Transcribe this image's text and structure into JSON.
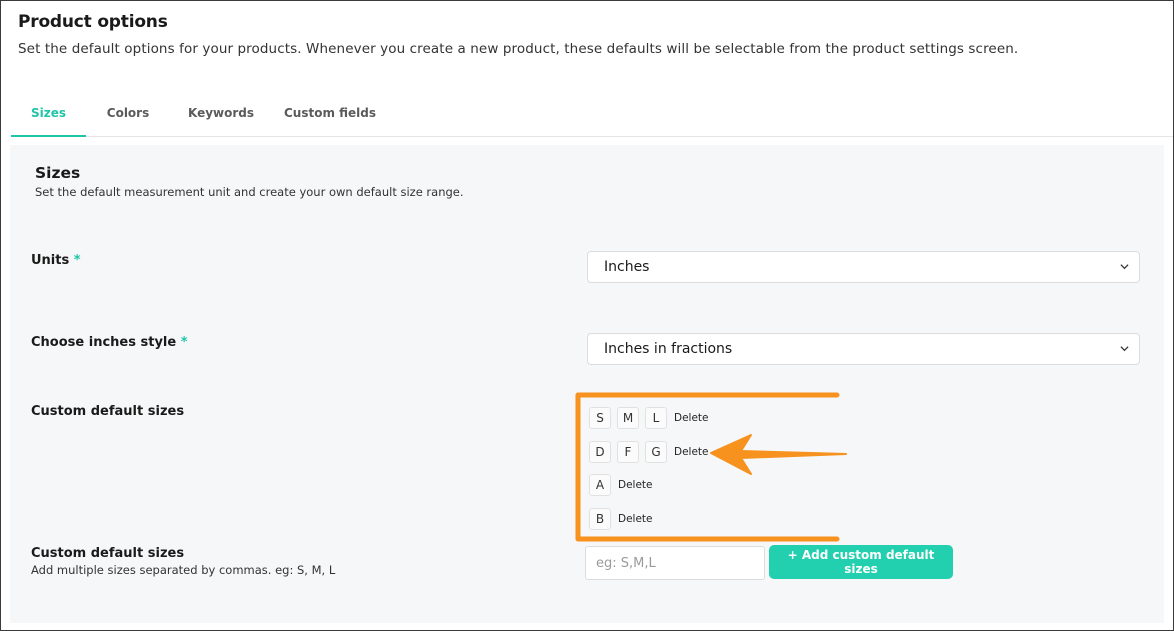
{
  "header": {
    "title": "Product options",
    "subtitle": "Set the default options for your products. Whenever you create a new product, these defaults will be selectable from the product settings screen."
  },
  "tabs": [
    {
      "label": "Sizes",
      "active": true
    },
    {
      "label": "Colors",
      "active": false
    },
    {
      "label": "Keywords",
      "active": false
    },
    {
      "label": "Custom fields",
      "active": false
    }
  ],
  "sizes_section": {
    "title": "Sizes",
    "description": "Set the default measurement unit and create your own default size range.",
    "units": {
      "label": "Units",
      "required_mark": "*",
      "value": "Inches"
    },
    "inches_style": {
      "label": "Choose inches style",
      "required_mark": "*",
      "value": "Inches in fractions"
    },
    "custom_sizes": {
      "label": "Custom default sizes",
      "rows": [
        {
          "sizes": [
            "S",
            "M",
            "L"
          ],
          "delete_label": "Delete"
        },
        {
          "sizes": [
            "D",
            "F",
            "G"
          ],
          "delete_label": "Delete"
        },
        {
          "sizes": [
            "A"
          ],
          "delete_label": "Delete"
        },
        {
          "sizes": [
            "B"
          ],
          "delete_label": "Delete"
        }
      ]
    },
    "add_sizes": {
      "label": "Custom default sizes",
      "help": "Add multiple sizes separated by commas. eg: S, M, L",
      "placeholder": "eg: S,M,L",
      "value": "",
      "button_label": "+ Add custom default sizes"
    }
  },
  "icons": {
    "select_chevron": "chevron-down-icon"
  },
  "colors": {
    "accent": "#20c4a8",
    "button": "#22cfae",
    "annotation": "#f7921e"
  }
}
